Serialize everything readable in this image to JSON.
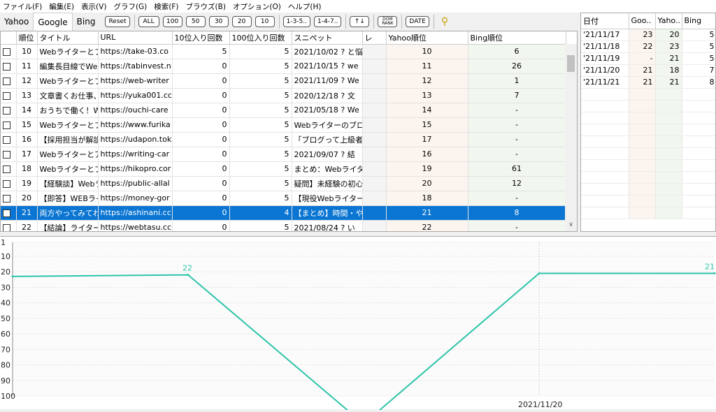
{
  "menu": [
    "ファイル(F)",
    "編集(E)",
    "表示(V)",
    "グラフ(G)",
    "検索(F)",
    "ブラウズ(B)",
    "オプション(O)",
    "ヘルプ(H)"
  ],
  "tabs": [
    "Yahoo",
    "Google",
    "Bing"
  ],
  "buttons": [
    "Reset",
    "ALL",
    "100",
    "50",
    "30",
    "20",
    "10",
    "1-3-5..",
    "1-4-7..",
    "↑↓",
    "DOM RANK",
    "DATE"
  ],
  "grid": {
    "headers": [
      "順位",
      "タイトル",
      "URL",
      "10位入り回数",
      "100位入り回数",
      "スニペット",
      "レ",
      "Yahoo順位",
      "Bing順位"
    ],
    "rows": [
      [
        "10",
        "Webライターとプロ",
        "https://take-03.co",
        "5",
        "5",
        "2021/10/02 ? と悩",
        "",
        "10",
        "6"
      ],
      [
        "11",
        "編集長目線でWe",
        "https://tabinvest.n",
        "0",
        "5",
        "2021/10/15 ? we",
        "",
        "11",
        "26"
      ],
      [
        "12",
        "Webライターとプロ",
        "https://web-writer",
        "0",
        "5",
        "2021/11/09 ? We",
        "",
        "12",
        "1"
      ],
      [
        "13",
        "文章書くお仕事、\\",
        "https://yuka001.cc",
        "0",
        "5",
        "2020/12/18 ? 文",
        "",
        "13",
        "7"
      ],
      [
        "14",
        "おうちで働く！WEI",
        "https://ouchi-care",
        "0",
        "5",
        "2021/05/18 ? We",
        "",
        "14",
        "-"
      ],
      [
        "15",
        "Webライターとプロ",
        "https://www.furika",
        "0",
        "5",
        "Webライターのブログ",
        "",
        "15",
        "-"
      ],
      [
        "16",
        "【採用担当が解説",
        "https://udapon.tok",
        "0",
        "5",
        "「ブログって上級者が",
        "",
        "17",
        "-"
      ],
      [
        "17",
        "Webライターとアフィ",
        "https://writing-car",
        "0",
        "5",
        "2021/09/07 ? 結",
        "",
        "16",
        "-"
      ],
      [
        "18",
        "Webライターとプロ",
        "https://hikopro.cor",
        "0",
        "5",
        "まとめ：Webライター",
        "",
        "19",
        "61"
      ],
      [
        "19",
        "【経験談】Webライ",
        "https://public-allal",
        "0",
        "5",
        "疑問】未経験の初心",
        "",
        "20",
        "12"
      ],
      [
        "20",
        "【即答】WEBライタ",
        "https://money-gor",
        "0",
        "5",
        "【現役Webライターカ",
        "",
        "18",
        "-"
      ],
      [
        "21",
        "両方やってみてわか",
        "https://ashinani.cc",
        "0",
        "4",
        "【まとめ】時間・やる気",
        "",
        "21",
        "8"
      ],
      [
        "22",
        "【結論】ライターとプ",
        "https://webtasu.cc",
        "0",
        "5",
        "2021/08/24 ? い",
        "",
        "22",
        "-"
      ]
    ],
    "selected_index": 11
  },
  "side": {
    "headers": [
      "日付",
      "Goo..",
      "Yaho..",
      "Bing"
    ],
    "rows": [
      [
        "'21/11/17",
        "23",
        "20",
        "5"
      ],
      [
        "'21/11/18",
        "22",
        "23",
        "5"
      ],
      [
        "'21/11/19",
        "-",
        "21",
        "5"
      ],
      [
        "'21/11/20",
        "21",
        "18",
        "7"
      ],
      [
        "'21/11/21",
        "21",
        "21",
        "8"
      ]
    ]
  },
  "chart_data": {
    "type": "line",
    "x": [
      "'21/11/17",
      "'21/11/18",
      "'21/11/19",
      "'21/11/20",
      "'21/11/21"
    ],
    "series": [
      {
        "values": [
          23,
          22,
          null,
          21,
          21
        ]
      }
    ],
    "yticks": [
      "1",
      "10",
      "20",
      "30",
      "40",
      "50",
      "60",
      "70",
      "80",
      "90",
      "100"
    ],
    "ylim": [
      1,
      100
    ],
    "y_inverted": true,
    "data_labels": [
      {
        "index": 1,
        "text": "22"
      },
      {
        "index": 4,
        "text": "21"
      }
    ],
    "xlabel_visible": "2021/11/20",
    "color": "#2ec4a9"
  }
}
